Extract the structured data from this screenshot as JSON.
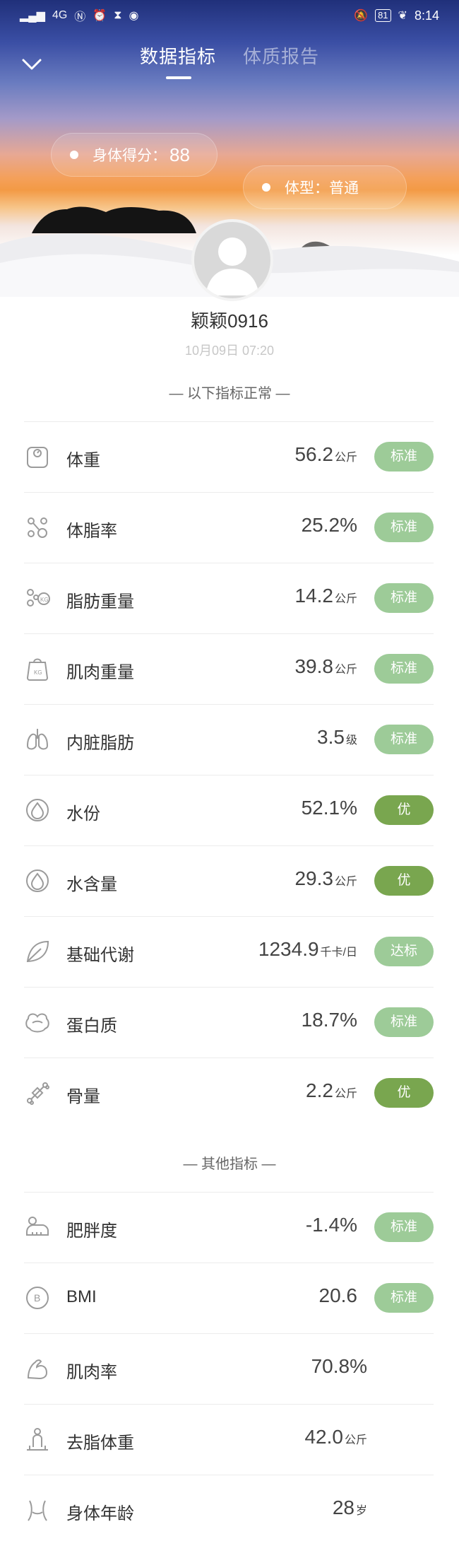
{
  "status_bar": {
    "network": "4G",
    "battery": "81",
    "time": "8:14"
  },
  "tabs": [
    {
      "label": "数据指标",
      "active": true
    },
    {
      "label": "体质报告",
      "active": false
    }
  ],
  "score": {
    "label": "身体得分：",
    "value": "88"
  },
  "body_type": {
    "label": "体型：普通"
  },
  "user": {
    "name": "颖颖0916",
    "datetime": "10月09日 07:20"
  },
  "section_normal": "— 以下指标正常 —",
  "normal_metrics": [
    {
      "icon": "scale-icon",
      "label": "体重",
      "value": "56.2",
      "unit": "公斤",
      "badge": "标准"
    },
    {
      "icon": "body-fat-icon",
      "label": "体脂率",
      "value": "25.2%",
      "unit": "",
      "badge": "标准"
    },
    {
      "icon": "fat-mass-icon",
      "label": "脂肪重量",
      "value": "14.2",
      "unit": "公斤",
      "badge": "标准"
    },
    {
      "icon": "muscle-mass-icon",
      "label": "肌肉重量",
      "value": "39.8",
      "unit": "公斤",
      "badge": "标准"
    },
    {
      "icon": "lungs-icon",
      "label": "内脏脂肪",
      "value": "3.5",
      "unit": "级",
      "badge": "标准"
    },
    {
      "icon": "water-drop-icon",
      "label": "水份",
      "value": "52.1%",
      "unit": "",
      "badge": "优"
    },
    {
      "icon": "water-drop-icon",
      "label": "水含量",
      "value": "29.3",
      "unit": "公斤",
      "badge": "优"
    },
    {
      "icon": "leaf-icon",
      "label": "基础代谢",
      "value": "1234.9",
      "unit": "千卡/日",
      "badge": "达标"
    },
    {
      "icon": "protein-icon",
      "label": "蛋白质",
      "value": "18.7%",
      "unit": "",
      "badge": "标准"
    },
    {
      "icon": "bone-icon",
      "label": "骨量",
      "value": "2.2",
      "unit": "公斤",
      "badge": "优"
    }
  ],
  "section_other": "— 其他指标 —",
  "other_metrics": [
    {
      "icon": "obesity-scale-icon",
      "label": "肥胖度",
      "value": "-1.4%",
      "unit": "",
      "badge": "标准"
    },
    {
      "icon": "bmi-icon",
      "label": "BMI",
      "value": "20.6",
      "unit": "",
      "badge": "标准"
    },
    {
      "icon": "arm-muscle-icon",
      "label": "肌肉率",
      "value": "70.8%",
      "unit": "",
      "badge": ""
    },
    {
      "icon": "person-icon",
      "label": "去脂体重",
      "value": "42.0",
      "unit": "公斤",
      "badge": ""
    },
    {
      "icon": "waist-icon",
      "label": "身体年龄",
      "value": "28",
      "unit": "岁",
      "badge": ""
    }
  ],
  "colors": {
    "badge_standard": "#9dcb98",
    "badge_excellent": "#79a64f"
  }
}
